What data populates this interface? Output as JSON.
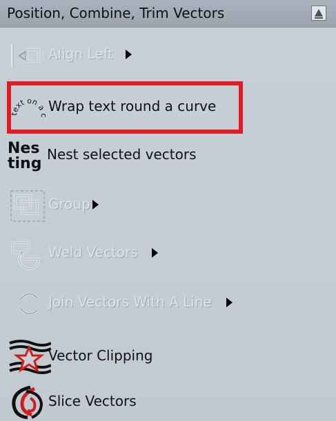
{
  "panel": {
    "title": "Position, Combine, Trim Vectors",
    "collapse_icon": "triangle-up-icon"
  },
  "tools": [
    {
      "label": "Align Left",
      "enabled": false,
      "has_submenu": true,
      "icon": "align-left-icon"
    },
    {
      "label": "Wrap text round a curve",
      "enabled": true,
      "has_submenu": false,
      "icon": "text-on-curve-icon",
      "icon_text": "text on a curve"
    },
    {
      "label": "Nest selected vectors",
      "enabled": true,
      "has_submenu": false,
      "icon": "nesting-icon",
      "icon_text": "Nes ting"
    },
    {
      "label": "Group",
      "enabled": false,
      "has_submenu": true,
      "icon": "group-icon"
    },
    {
      "label": "Weld Vectors",
      "enabled": false,
      "has_submenu": true,
      "icon": "weld-vectors-icon"
    },
    {
      "label": "Join Vectors With A Line",
      "enabled": false,
      "has_submenu": true,
      "icon": "join-line-icon"
    },
    {
      "label": "Vector Clipping",
      "enabled": true,
      "has_submenu": false,
      "icon": "vector-clipping-icon"
    },
    {
      "label": "Slice Vectors",
      "enabled": true,
      "has_submenu": false,
      "icon": "slice-vectors-icon"
    }
  ],
  "highlight": {
    "target": "Wrap text round a curve",
    "color": "#e01b24"
  }
}
